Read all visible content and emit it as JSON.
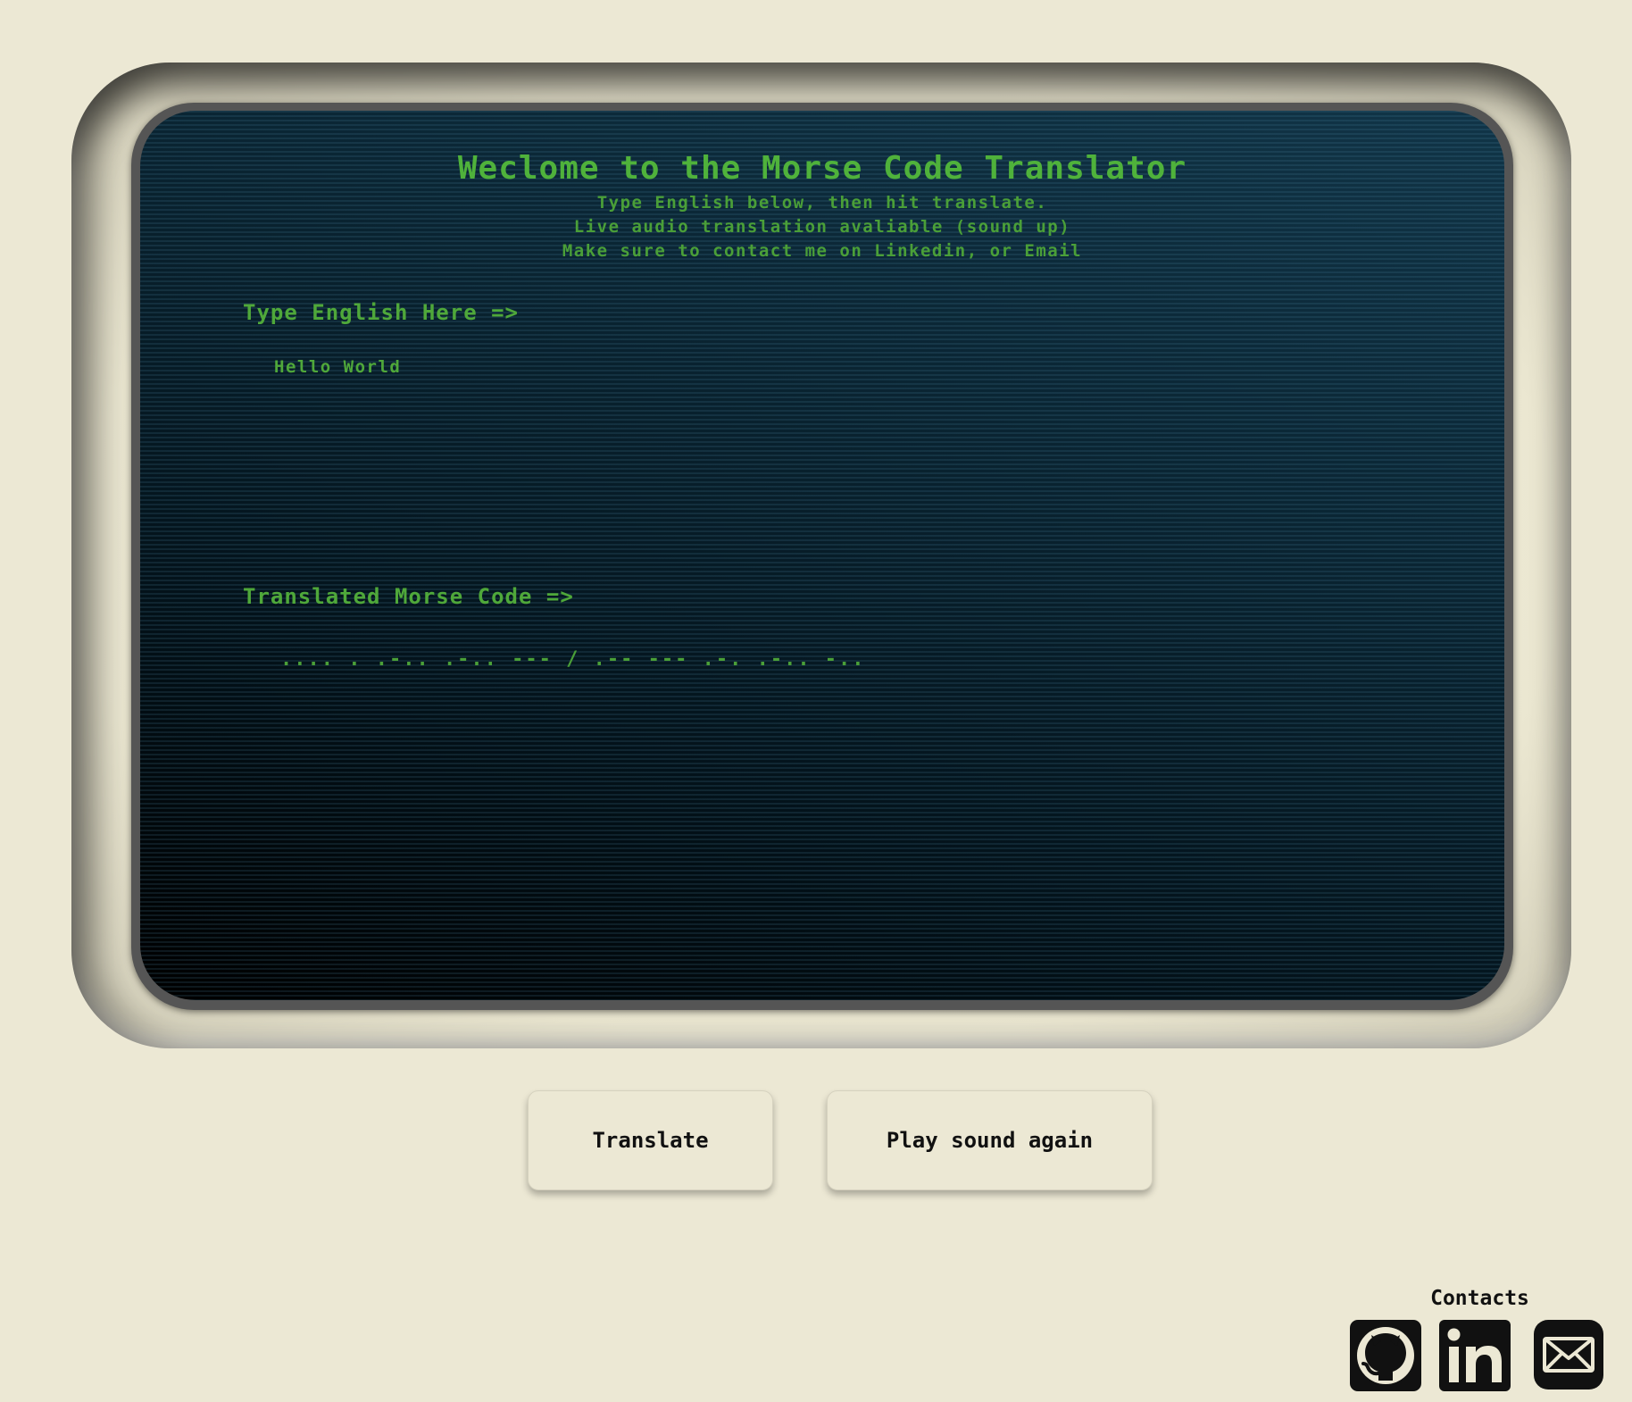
{
  "screen": {
    "title": "Weclome to the Morse Code Translator",
    "subtitle_lines": [
      "Type English below, then hit translate.",
      "Live audio translation avaliable (sound up)",
      "Make sure to contact me on Linkedin, or Email"
    ],
    "english_label": "Type English Here =>",
    "english_input_value": "Hello World",
    "morse_label": "Translated Morse Code =>",
    "morse_output": ".... . .-.. .-.. --- / .-- --- .-. .-.. -.."
  },
  "buttons": {
    "translate_label": "Translate",
    "play_sound_label": "Play sound again"
  },
  "contacts": {
    "title": "Contacts",
    "icons": [
      "github-icon",
      "linkedin-icon",
      "email-icon"
    ]
  },
  "colors": {
    "background": "#ece8d4",
    "terminal_text": "#4fa83a",
    "screen_dark": "#000000",
    "screen_light": "#113548",
    "frame": "#555555"
  }
}
